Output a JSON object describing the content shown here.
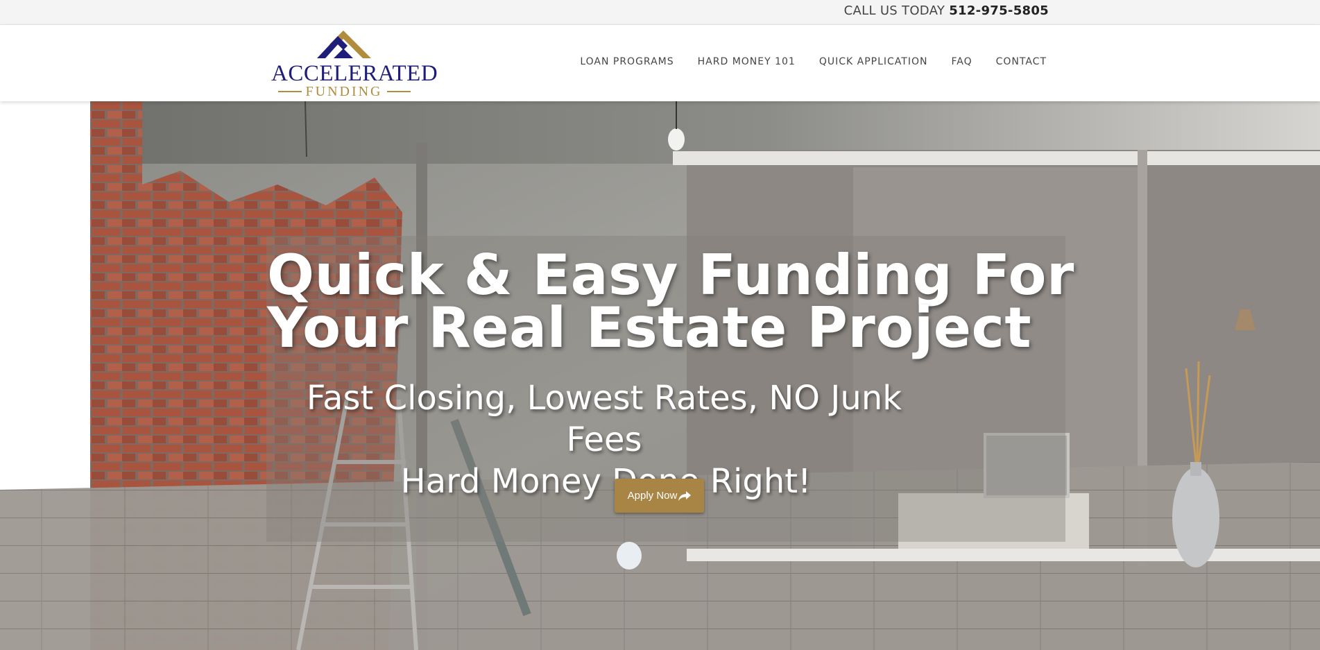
{
  "topbar": {
    "call_label": "CALL US TODAY",
    "phone": "512-975-5805"
  },
  "logo": {
    "word": "ACCELERATED",
    "sub": "FUNDING",
    "colors": {
      "navy": "#1f1d7a",
      "gold": "#b08d3c"
    }
  },
  "nav": {
    "items": [
      {
        "label": "LOAN PROGRAMS"
      },
      {
        "label": "HARD MONEY 101"
      },
      {
        "label": "QUICK APPLICATION"
      },
      {
        "label": "FAQ"
      },
      {
        "label": "CONTACT"
      }
    ]
  },
  "hero": {
    "headline_line1": "Quick & Easy Funding For",
    "headline_line2": "Your Real Estate Project",
    "sub_line1": "Fast Closing, Lowest Rates, NO Junk Fees",
    "sub_line2": "Hard Money Done Right!",
    "button_label": "Apply Now",
    "button_icon": "share-arrow-icon",
    "accent": "#a88544"
  }
}
